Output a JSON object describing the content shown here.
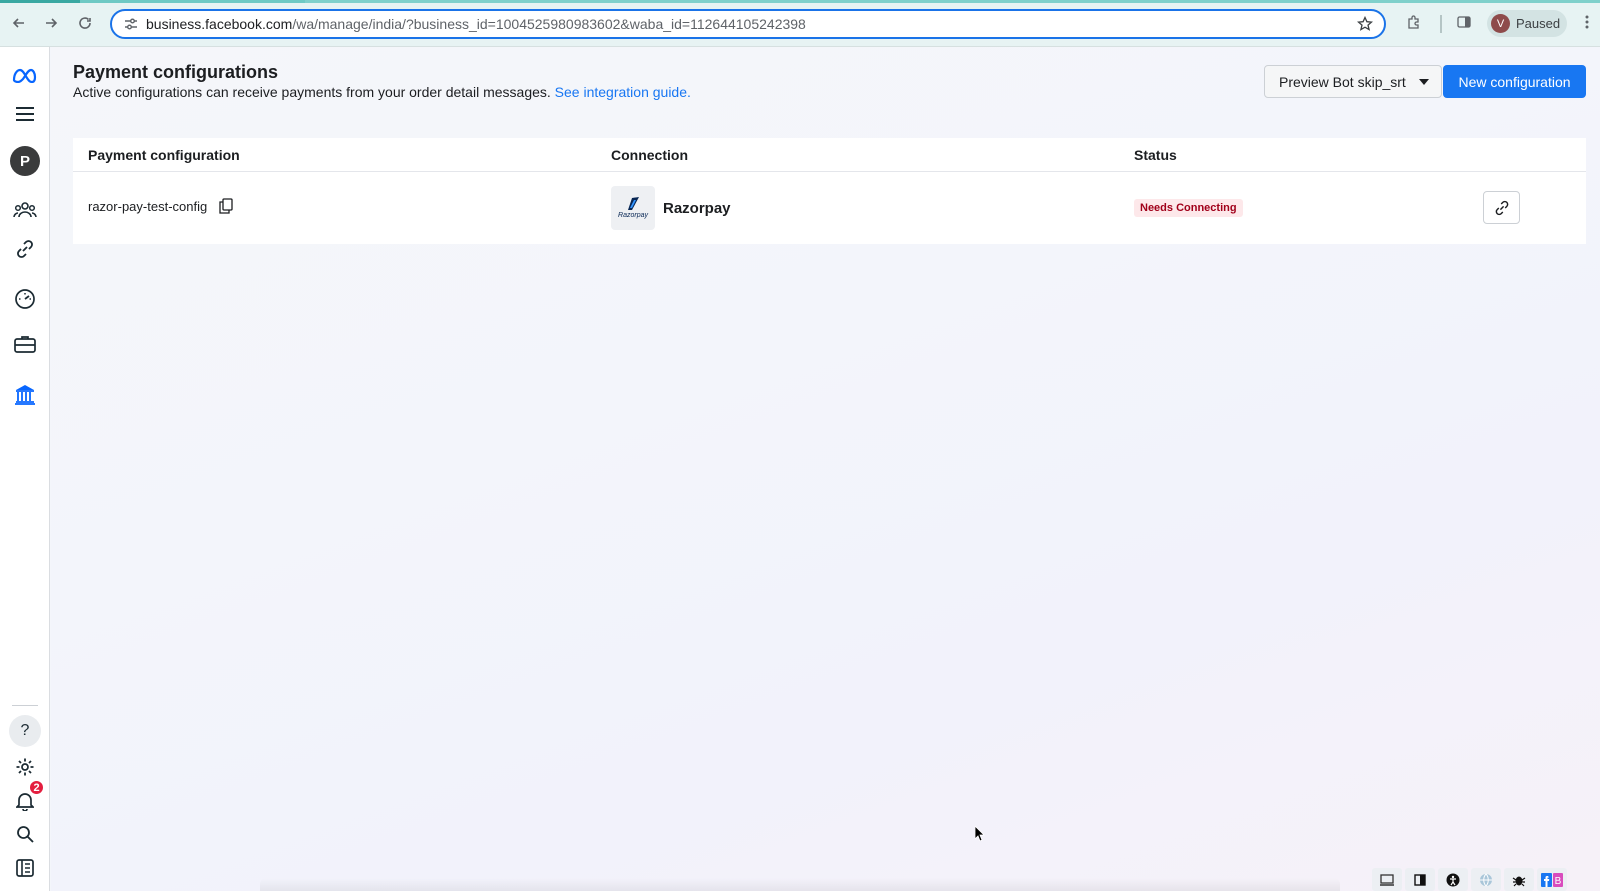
{
  "browser": {
    "url_host": "business.facebook.com",
    "url_path": "/wa/manage/india/?business_id=1004525980983602&waba_id=112644105242398",
    "profile_initial": "V",
    "profile_label": "Paused"
  },
  "rail": {
    "avatar_letter": "P",
    "notifications_count": "2",
    "help_label": "?"
  },
  "page": {
    "title": "Payment configurations",
    "subtitle": "Active configurations can receive payments from your order detail messages.",
    "guide_link": "See integration guide.",
    "dropdown_label": "Preview Bot skip_srt",
    "new_config_label": "New configuration"
  },
  "table": {
    "headers": [
      "Payment configuration",
      "Connection",
      "Status"
    ],
    "rows": [
      {
        "name": "razor-pay-test-config",
        "connection": "Razorpay",
        "logo_text": "Razorpay",
        "status": "Needs Connecting"
      }
    ]
  },
  "colors": {
    "accent": "#1877f2",
    "status_text": "#a1001a",
    "status_bg": "#fde8ea"
  }
}
